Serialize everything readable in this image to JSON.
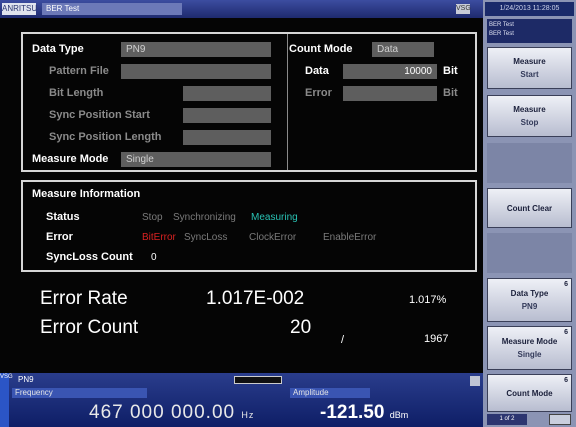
{
  "titlebar": {
    "logo": "ANRITSU",
    "app_title": "BER Test",
    "icon_label": "VSG"
  },
  "side": {
    "datetime": "1/24/2013 11:28:05",
    "context_line1": "BER Test",
    "context_line2": "BER Test",
    "buttons": [
      {
        "label": "Measure",
        "sub": "Start"
      },
      {
        "label": "Measure",
        "sub": "Stop"
      },
      {
        "label": "Count Clear",
        "sub": ""
      },
      {
        "label": "Data Type",
        "sub": "PN9",
        "tab": "6"
      },
      {
        "label": "Measure Mode",
        "sub": "Single",
        "tab": "6"
      },
      {
        "label": "Count Mode",
        "sub": "",
        "tab": "6"
      }
    ],
    "page_indicator": "1 of 2"
  },
  "settings": {
    "data_type_label": "Data Type",
    "data_type_value": "PN9",
    "pattern_file_label": "Pattern File",
    "bit_length_label": "Bit Length",
    "sync_start_label": "Sync Position Start",
    "sync_length_label": "Sync Position Length",
    "measure_mode_label": "Measure Mode",
    "measure_mode_value": "Single",
    "count_mode_label": "Count Mode",
    "count_mode_value": "Data",
    "data_label": "Data",
    "data_value": "10000",
    "data_unit": "Bit",
    "error_label": "Error",
    "error_unit": "Bit"
  },
  "measure_info": {
    "header": "Measure Information",
    "status_label": "Status",
    "status_states": [
      "Stop",
      "Synchronizing",
      "Measuring"
    ],
    "error_label": "Error",
    "error_states": [
      "BitError",
      "SyncLoss",
      "ClockError",
      "EnableError"
    ],
    "syncloss_label": "SyncLoss Count",
    "syncloss_value": "0"
  },
  "results": {
    "error_rate_label": "Error Rate",
    "error_rate_value": "1.017E-002",
    "error_rate_percent": "1.017%",
    "error_count_label": "Error Count",
    "error_count_value": "20",
    "slash": "/",
    "total_count": "1967"
  },
  "bottombar": {
    "vsg_label": "VSG",
    "pattern": "PN9",
    "frequency_label": "Frequency",
    "frequency_value": "467 000 000.00",
    "frequency_unit": "Hz",
    "amplitude_label": "Amplitude",
    "amplitude_value": "-121.50",
    "amplitude_unit": "dBm"
  },
  "colors": {
    "active_status": "#29c2b4",
    "active_error": "#d82222",
    "inactive": "#7a7a7a"
  }
}
